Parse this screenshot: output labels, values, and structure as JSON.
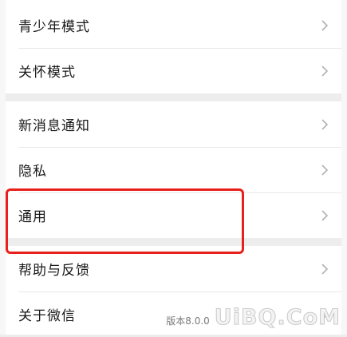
{
  "settings": {
    "group1": [
      {
        "label": "青少年模式"
      },
      {
        "label": "关怀模式"
      }
    ],
    "group2": [
      {
        "label": "新消息通知"
      },
      {
        "label": "隐私"
      },
      {
        "label": "通用"
      }
    ],
    "group3": [
      {
        "label": "帮助与反馈"
      },
      {
        "label": "关于微信"
      }
    ]
  },
  "highlight": {
    "target": "通用",
    "color": "#e8201c"
  },
  "watermark": {
    "brand": "UiBQ.CoM",
    "sub": "版本8.0.0"
  },
  "icons": {
    "row_arrow": "chevron-right-icon"
  }
}
